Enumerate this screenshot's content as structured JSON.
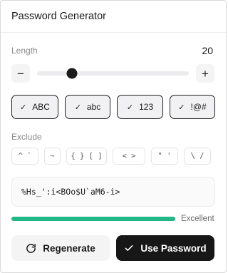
{
  "header": {
    "title": "Password Generator"
  },
  "length": {
    "label": "Length",
    "value": "20",
    "minus_glyph": "−",
    "plus_glyph": "+",
    "slider_fraction": 0.23
  },
  "charsets": [
    {
      "label": "ABC",
      "checked": true
    },
    {
      "label": "abc",
      "checked": true
    },
    {
      "label": "123",
      "checked": true
    },
    {
      "label": "!@#",
      "checked": true
    }
  ],
  "check_glyph": "✓",
  "exclude": {
    "label": "Exclude",
    "groups": [
      "^ `",
      "~",
      "{ } [ ]",
      "< >",
      "\" '",
      "\\ /"
    ]
  },
  "password": {
    "value": "%Hs_':i<BOo$U`aM6-i>"
  },
  "strength": {
    "label": "Excellent",
    "fraction": 1.0,
    "color": "#22b585"
  },
  "actions": {
    "regenerate_label": "Regenerate",
    "use_label": "Use Password"
  },
  "icons": {
    "regenerate": "refresh-icon",
    "use": "check-icon"
  }
}
